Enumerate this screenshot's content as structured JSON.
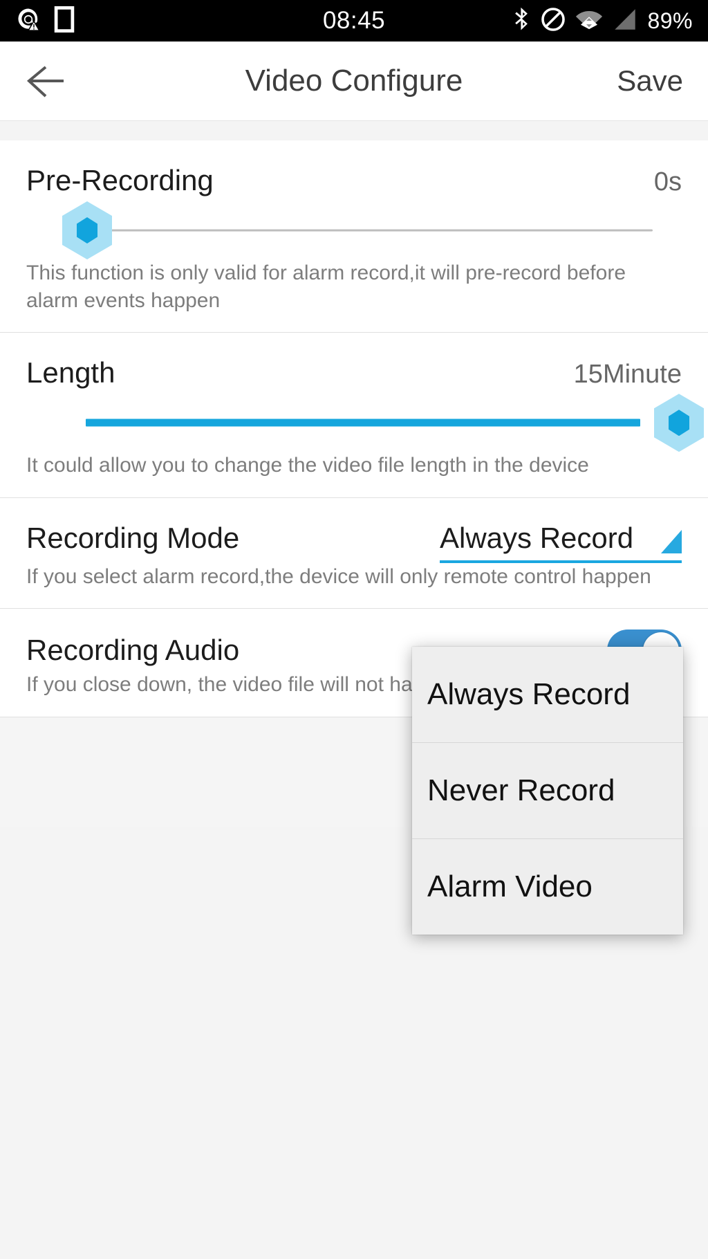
{
  "statusbar": {
    "time": "08:45",
    "battery": "89%",
    "icons_left": [
      "email-warning-icon",
      "sim-card-icon"
    ],
    "icons_right": [
      "bluetooth-icon",
      "do-not-disturb-icon",
      "wifi-icon",
      "cellular-signal-icon"
    ]
  },
  "header": {
    "back_icon": "back-arrow-icon",
    "title": "Video Configure",
    "save_label": "Save"
  },
  "sections": {
    "pre_recording": {
      "title": "Pre-Recording",
      "value": "0s",
      "description": "This function is only valid for alarm record,it will pre-record before alarm events happen",
      "slider_percent": 0
    },
    "length": {
      "title": "Length",
      "value": "15Minute",
      "description": "It could allow you to change the video file length in the device",
      "slider_percent": 100
    },
    "recording_mode": {
      "title": "Recording Mode",
      "selected": "Always Record",
      "description": "If you select alarm record,the device will only remote control happen",
      "caret_icon": "caret-down-icon",
      "options": [
        "Always Record",
        "Never Record",
        "Alarm Video"
      ]
    },
    "recording_audio": {
      "title": "Recording Audio",
      "description": "If you close down, the video file will not have",
      "toggle_on": true
    }
  },
  "colors": {
    "accent": "#16a6dd",
    "accent_light": "#a8e0f5",
    "toggle_on": "#3a90cf",
    "menu_bg": "#eeeeee",
    "text_primary": "#1c1c1c",
    "text_secondary": "#7d7d7d"
  }
}
